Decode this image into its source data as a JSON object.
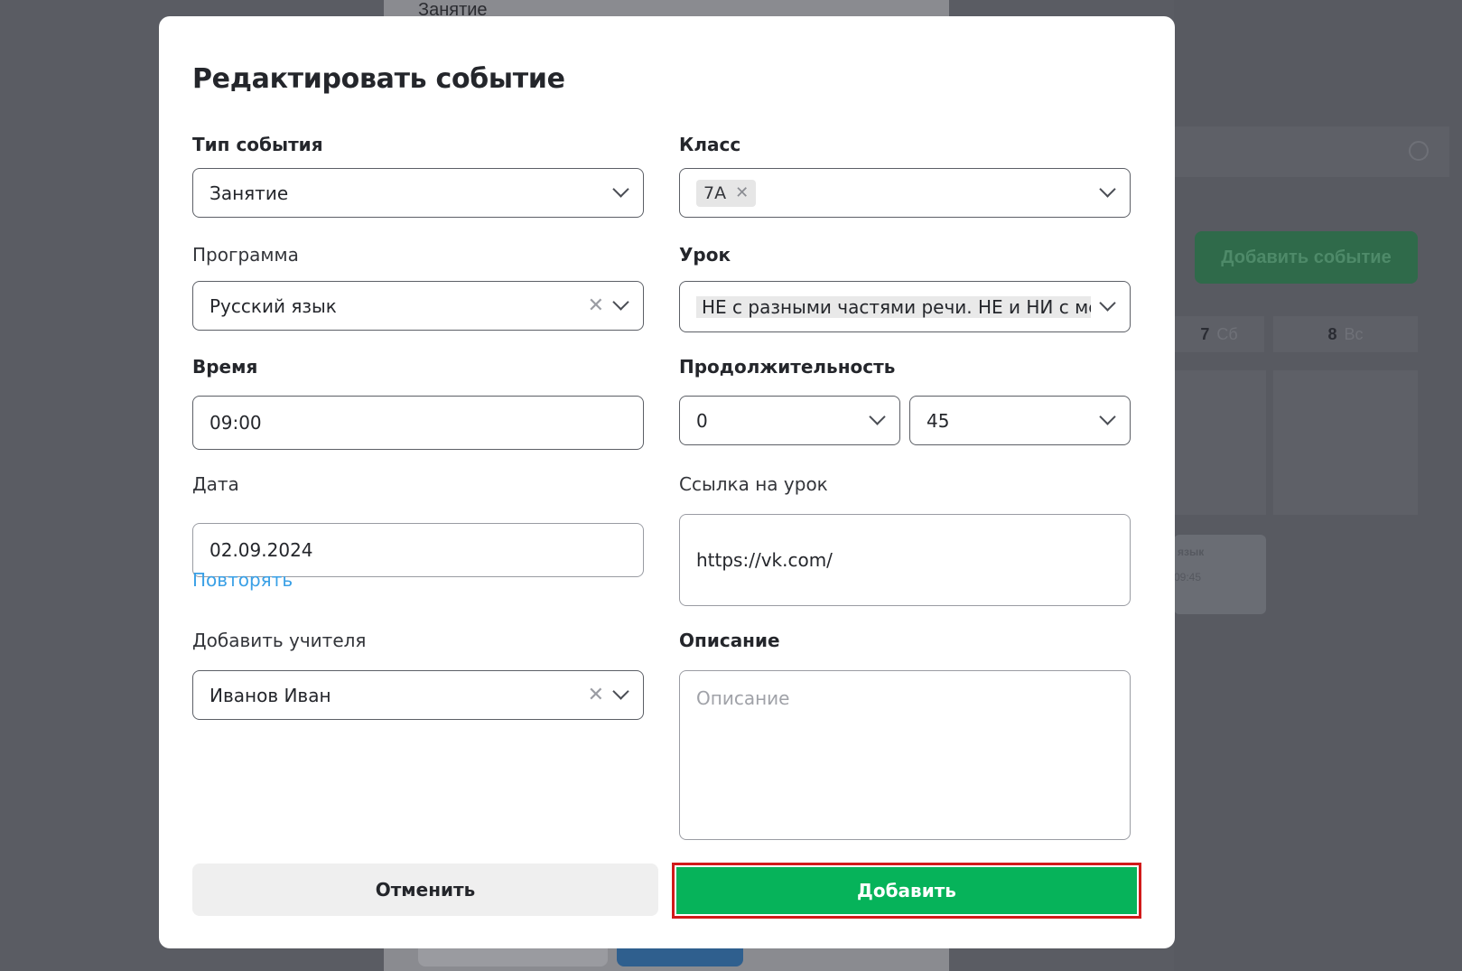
{
  "background": {
    "behind_title": "Занятие",
    "add_event_label": "Добавить событие",
    "days": [
      {
        "num": "7",
        "name": "Сб"
      },
      {
        "num": "8",
        "name": "Вс"
      }
    ],
    "event_title": "язык",
    "event_time": "09:45"
  },
  "modal": {
    "title": "Редактировать событие",
    "event_type": {
      "label": "Тип события",
      "value": "Занятие"
    },
    "class": {
      "label": "Класс",
      "tag": "7А"
    },
    "program": {
      "label": "Программа",
      "value": "Русский язык"
    },
    "lesson": {
      "label": "Урок",
      "value": "НЕ с разными частями речи. НЕ и НИ с местоимениями"
    },
    "time": {
      "label": "Время",
      "value": "09:00"
    },
    "duration": {
      "label": "Продолжительность",
      "hours": "0",
      "minutes": "45"
    },
    "date": {
      "label": "Дата",
      "value": "02.09.2024",
      "repeat_label": "Повторять"
    },
    "lesson_link": {
      "label": "Ссылка на урок",
      "value": "https://vk.com/"
    },
    "teacher": {
      "label": "Добавить учителя",
      "value": "Иванов Иван"
    },
    "description": {
      "label": "Описание",
      "placeholder": "Описание"
    },
    "cancel_label": "Отменить",
    "submit_label": "Добавить"
  },
  "colors": {
    "accent_green": "#06b35a",
    "highlight_red": "#d11a1a",
    "link_blue": "#3aa0e6"
  }
}
